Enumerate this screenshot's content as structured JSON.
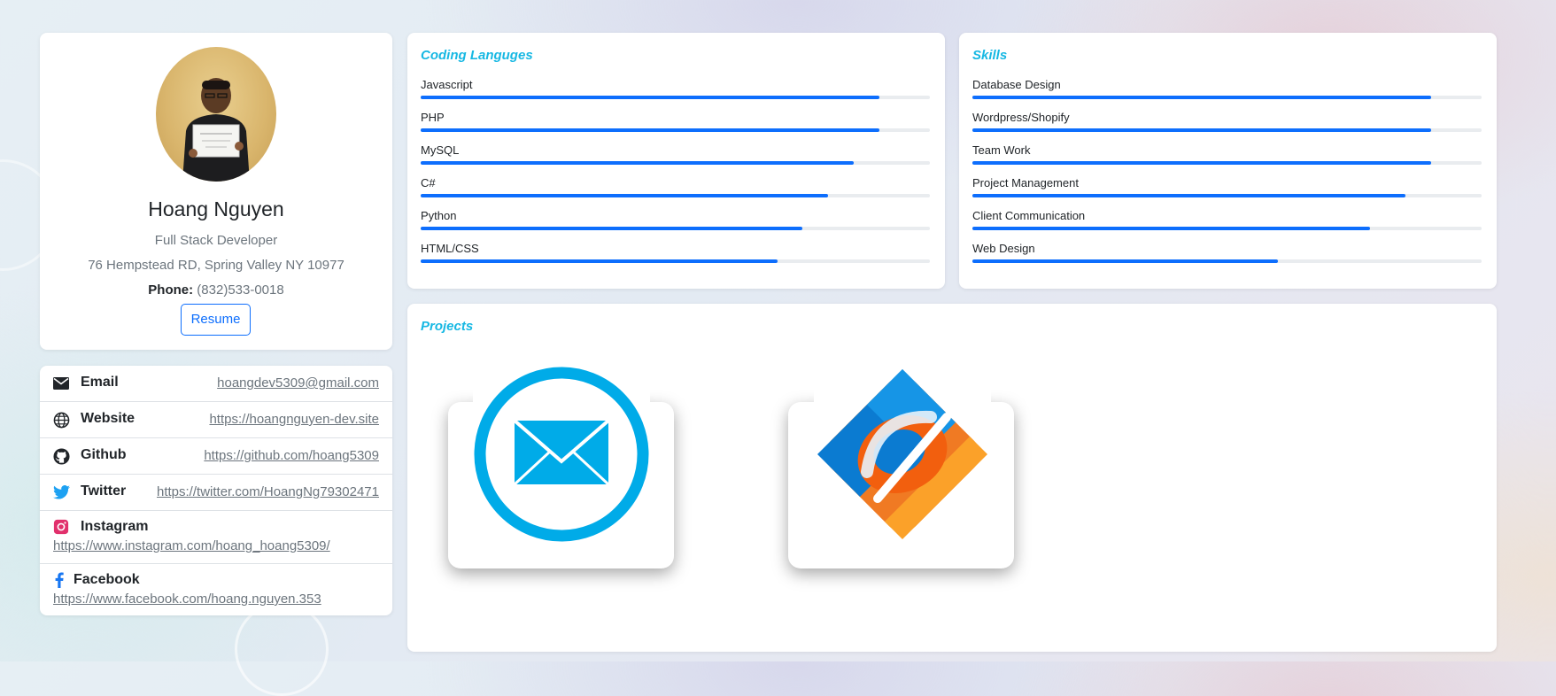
{
  "profile": {
    "name": "Hoang Nguyen",
    "title": "Full Stack Developer",
    "address": "76 Hempstead RD, Spring Valley NY 10977",
    "phone_label": "Phone:",
    "phone": "(832)533-0018",
    "resume_label": "Resume"
  },
  "links": [
    {
      "icon": "mail-icon",
      "label": "Email",
      "url": "hoangdev5309@gmail.com"
    },
    {
      "icon": "globe-icon",
      "label": "Website",
      "url": "https://hoangnguyen-dev.site"
    },
    {
      "icon": "github-icon",
      "label": "Github",
      "url": "https://github.com/hoang5309"
    },
    {
      "icon": "twitter-icon",
      "label": "Twitter",
      "url": "https://twitter.com/HoangNg79302471"
    },
    {
      "icon": "instagram-icon",
      "label": "Instagram",
      "url": "https://www.instagram.com/hoang_hoang5309/"
    },
    {
      "icon": "facebook-icon",
      "label": "Facebook",
      "url": "https://www.facebook.com/hoang.nguyen.353"
    }
  ],
  "coding": {
    "title": "Coding Languges",
    "items": [
      {
        "label": "Javascript",
        "value": 90
      },
      {
        "label": "PHP",
        "value": 90
      },
      {
        "label": "MySQL",
        "value": 85
      },
      {
        "label": "C#",
        "value": 80
      },
      {
        "label": "Python",
        "value": 75
      },
      {
        "label": "HTML/CSS",
        "value": 70
      }
    ]
  },
  "skills": {
    "title": "Skills",
    "items": [
      {
        "label": "Database Design",
        "value": 90
      },
      {
        "label": "Wordpress/Shopify",
        "value": 90
      },
      {
        "label": "Team Work",
        "value": 90
      },
      {
        "label": "Project Management",
        "value": 85
      },
      {
        "label": "Client Communication",
        "value": 78
      },
      {
        "label": "Web Design",
        "value": 60
      }
    ]
  },
  "projects": {
    "title": "Projects",
    "items": [
      {
        "icon": "email-app-icon"
      },
      {
        "icon": "browser-logo-icon"
      }
    ]
  },
  "colors": {
    "accent": "#17b8e3",
    "bar": "#0d6efd",
    "track": "#e9ecef",
    "muted": "#6c757d"
  }
}
